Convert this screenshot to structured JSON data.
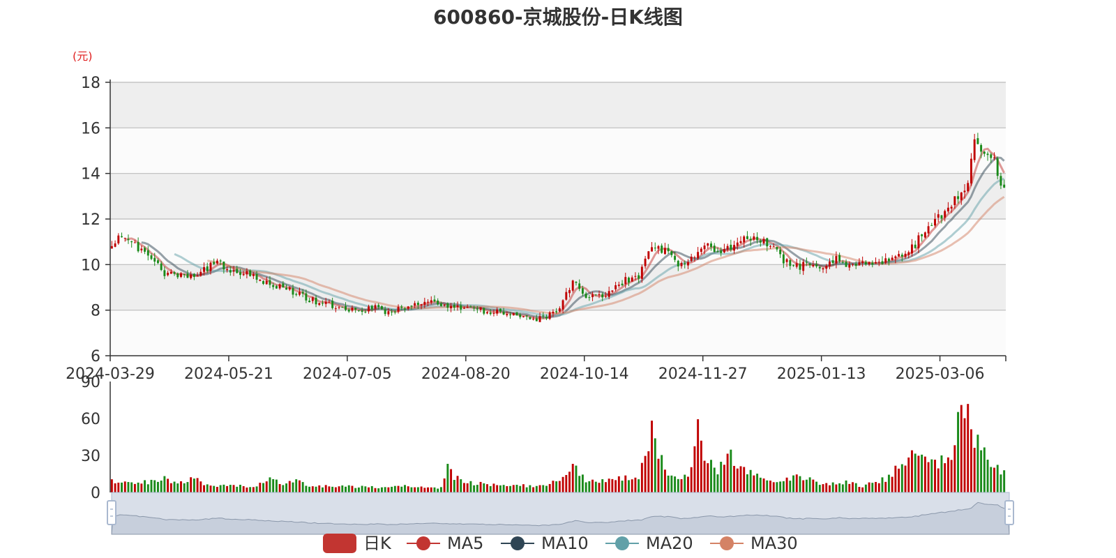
{
  "chart_data": {
    "type": "candlestick",
    "title": "600860-京城股份-日K线图",
    "y_unit_label": "(元)",
    "price_axis": {
      "ylim": [
        6,
        18
      ],
      "ticks": [
        6,
        8,
        10,
        12,
        14,
        16,
        18
      ]
    },
    "volume_axis": {
      "ylim": [
        0,
        90
      ],
      "ticks": [
        0,
        30,
        60,
        90
      ]
    },
    "x_tick_labels": [
      "2024-03-29",
      "2024-05-21",
      "2024-07-05",
      "2024-08-20",
      "2024-10-14",
      "2024-11-27",
      "2025-01-13",
      "2025-03-06"
    ],
    "x_tick_indices": [
      0,
      36,
      72,
      108,
      144,
      180,
      216,
      252
    ],
    "trading_days": 272,
    "price_anchors": [
      [
        0,
        11.0
      ],
      [
        4,
        11.3
      ],
      [
        8,
        10.7
      ],
      [
        12,
        10.2
      ],
      [
        16,
        9.6
      ],
      [
        20,
        9.6
      ],
      [
        24,
        9.5
      ],
      [
        28,
        9.8
      ],
      [
        32,
        10.1
      ],
      [
        36,
        9.8
      ],
      [
        40,
        9.6
      ],
      [
        44,
        9.4
      ],
      [
        48,
        9.1
      ],
      [
        52,
        9.0
      ],
      [
        56,
        8.7
      ],
      [
        60,
        8.5
      ],
      [
        64,
        8.3
      ],
      [
        68,
        8.2
      ],
      [
        72,
        8.0
      ],
      [
        76,
        8.0
      ],
      [
        80,
        8.1
      ],
      [
        84,
        7.9
      ],
      [
        88,
        8.1
      ],
      [
        92,
        8.2
      ],
      [
        96,
        8.4
      ],
      [
        100,
        8.3
      ],
      [
        104,
        8.2
      ],
      [
        108,
        8.1
      ],
      [
        112,
        8.0
      ],
      [
        116,
        7.9
      ],
      [
        120,
        7.9
      ],
      [
        124,
        7.8
      ],
      [
        128,
        7.6
      ],
      [
        132,
        7.7
      ],
      [
        136,
        8.0
      ],
      [
        140,
        9.3
      ],
      [
        142,
        9.0
      ],
      [
        144,
        8.5
      ],
      [
        148,
        8.6
      ],
      [
        152,
        8.9
      ],
      [
        156,
        9.3
      ],
      [
        160,
        9.5
      ],
      [
        164,
        10.8
      ],
      [
        168,
        10.6
      ],
      [
        172,
        10.0
      ],
      [
        176,
        10.3
      ],
      [
        180,
        10.8
      ],
      [
        184,
        10.6
      ],
      [
        188,
        10.8
      ],
      [
        192,
        11.3
      ],
      [
        196,
        11.2
      ],
      [
        200,
        10.8
      ],
      [
        204,
        10.2
      ],
      [
        208,
        9.9
      ],
      [
        212,
        10.0
      ],
      [
        216,
        9.8
      ],
      [
        220,
        10.2
      ],
      [
        224,
        10.0
      ],
      [
        228,
        10.1
      ],
      [
        232,
        10.0
      ],
      [
        236,
        10.2
      ],
      [
        240,
        10.5
      ],
      [
        244,
        10.9
      ],
      [
        248,
        11.8
      ],
      [
        252,
        12.2
      ],
      [
        256,
        12.8
      ],
      [
        260,
        13.5
      ],
      [
        262,
        15.6
      ],
      [
        264,
        15.2
      ],
      [
        266,
        14.6
      ],
      [
        268,
        14.6
      ],
      [
        270,
        13.3
      ],
      [
        271,
        13.2
      ]
    ],
    "volume_anchors": [
      [
        0,
        10
      ],
      [
        10,
        8
      ],
      [
        16,
        12
      ],
      [
        20,
        6
      ],
      [
        24,
        12
      ],
      [
        28,
        7
      ],
      [
        36,
        5
      ],
      [
        44,
        5
      ],
      [
        48,
        13
      ],
      [
        52,
        6
      ],
      [
        56,
        9
      ],
      [
        60,
        5
      ],
      [
        72,
        5
      ],
      [
        80,
        4
      ],
      [
        88,
        5
      ],
      [
        100,
        4
      ],
      [
        102,
        20
      ],
      [
        104,
        12
      ],
      [
        108,
        8
      ],
      [
        120,
        6
      ],
      [
        130,
        5
      ],
      [
        134,
        8
      ],
      [
        138,
        15
      ],
      [
        140,
        22
      ],
      [
        144,
        10
      ],
      [
        150,
        9
      ],
      [
        156,
        12
      ],
      [
        160,
        10
      ],
      [
        164,
        50
      ],
      [
        166,
        30
      ],
      [
        170,
        14
      ],
      [
        174,
        12
      ],
      [
        176,
        18
      ],
      [
        178,
        55
      ],
      [
        180,
        28
      ],
      [
        184,
        18
      ],
      [
        188,
        30
      ],
      [
        190,
        18
      ],
      [
        196,
        14
      ],
      [
        200,
        10
      ],
      [
        204,
        10
      ],
      [
        208,
        12
      ],
      [
        212,
        10
      ],
      [
        216,
        6
      ],
      [
        224,
        8
      ],
      [
        228,
        5
      ],
      [
        232,
        9
      ],
      [
        236,
        12
      ],
      [
        240,
        28
      ],
      [
        244,
        30
      ],
      [
        248,
        26
      ],
      [
        252,
        25
      ],
      [
        256,
        35
      ],
      [
        258,
        72
      ],
      [
        260,
        58
      ],
      [
        262,
        45
      ],
      [
        264,
        36
      ],
      [
        266,
        28
      ],
      [
        268,
        20
      ],
      [
        271,
        17
      ]
    ],
    "ma_series": [
      {
        "name": "MA5",
        "window": 5,
        "color": "#c23531"
      },
      {
        "name": "MA10",
        "window": 10,
        "color": "#2f4554"
      },
      {
        "name": "MA20",
        "window": 20,
        "color": "#61a0a8"
      },
      {
        "name": "MA30",
        "window": 30,
        "color": "#d48265"
      }
    ],
    "legend": [
      {
        "label": "日K",
        "color": "#c23531"
      },
      {
        "label": "MA5",
        "color": "#c23531"
      },
      {
        "label": "MA10",
        "color": "#2f4554"
      },
      {
        "label": "MA20",
        "color": "#61a0a8"
      },
      {
        "label": "MA30",
        "color": "#d48265"
      }
    ],
    "colors": {
      "up": "#c00000",
      "down": "#1a8a1a",
      "grid_band_dark": "#eeeeee",
      "grid_band_light": "#fbfbfb",
      "grid_line": "#bbbbbb",
      "axis": "#333333",
      "zoom_fill": "#d9dfe9",
      "zoom_border": "#a9b8cf",
      "zoom_line": "#8a97aa"
    },
    "grid": true,
    "legend_placement": "bottom-center"
  }
}
